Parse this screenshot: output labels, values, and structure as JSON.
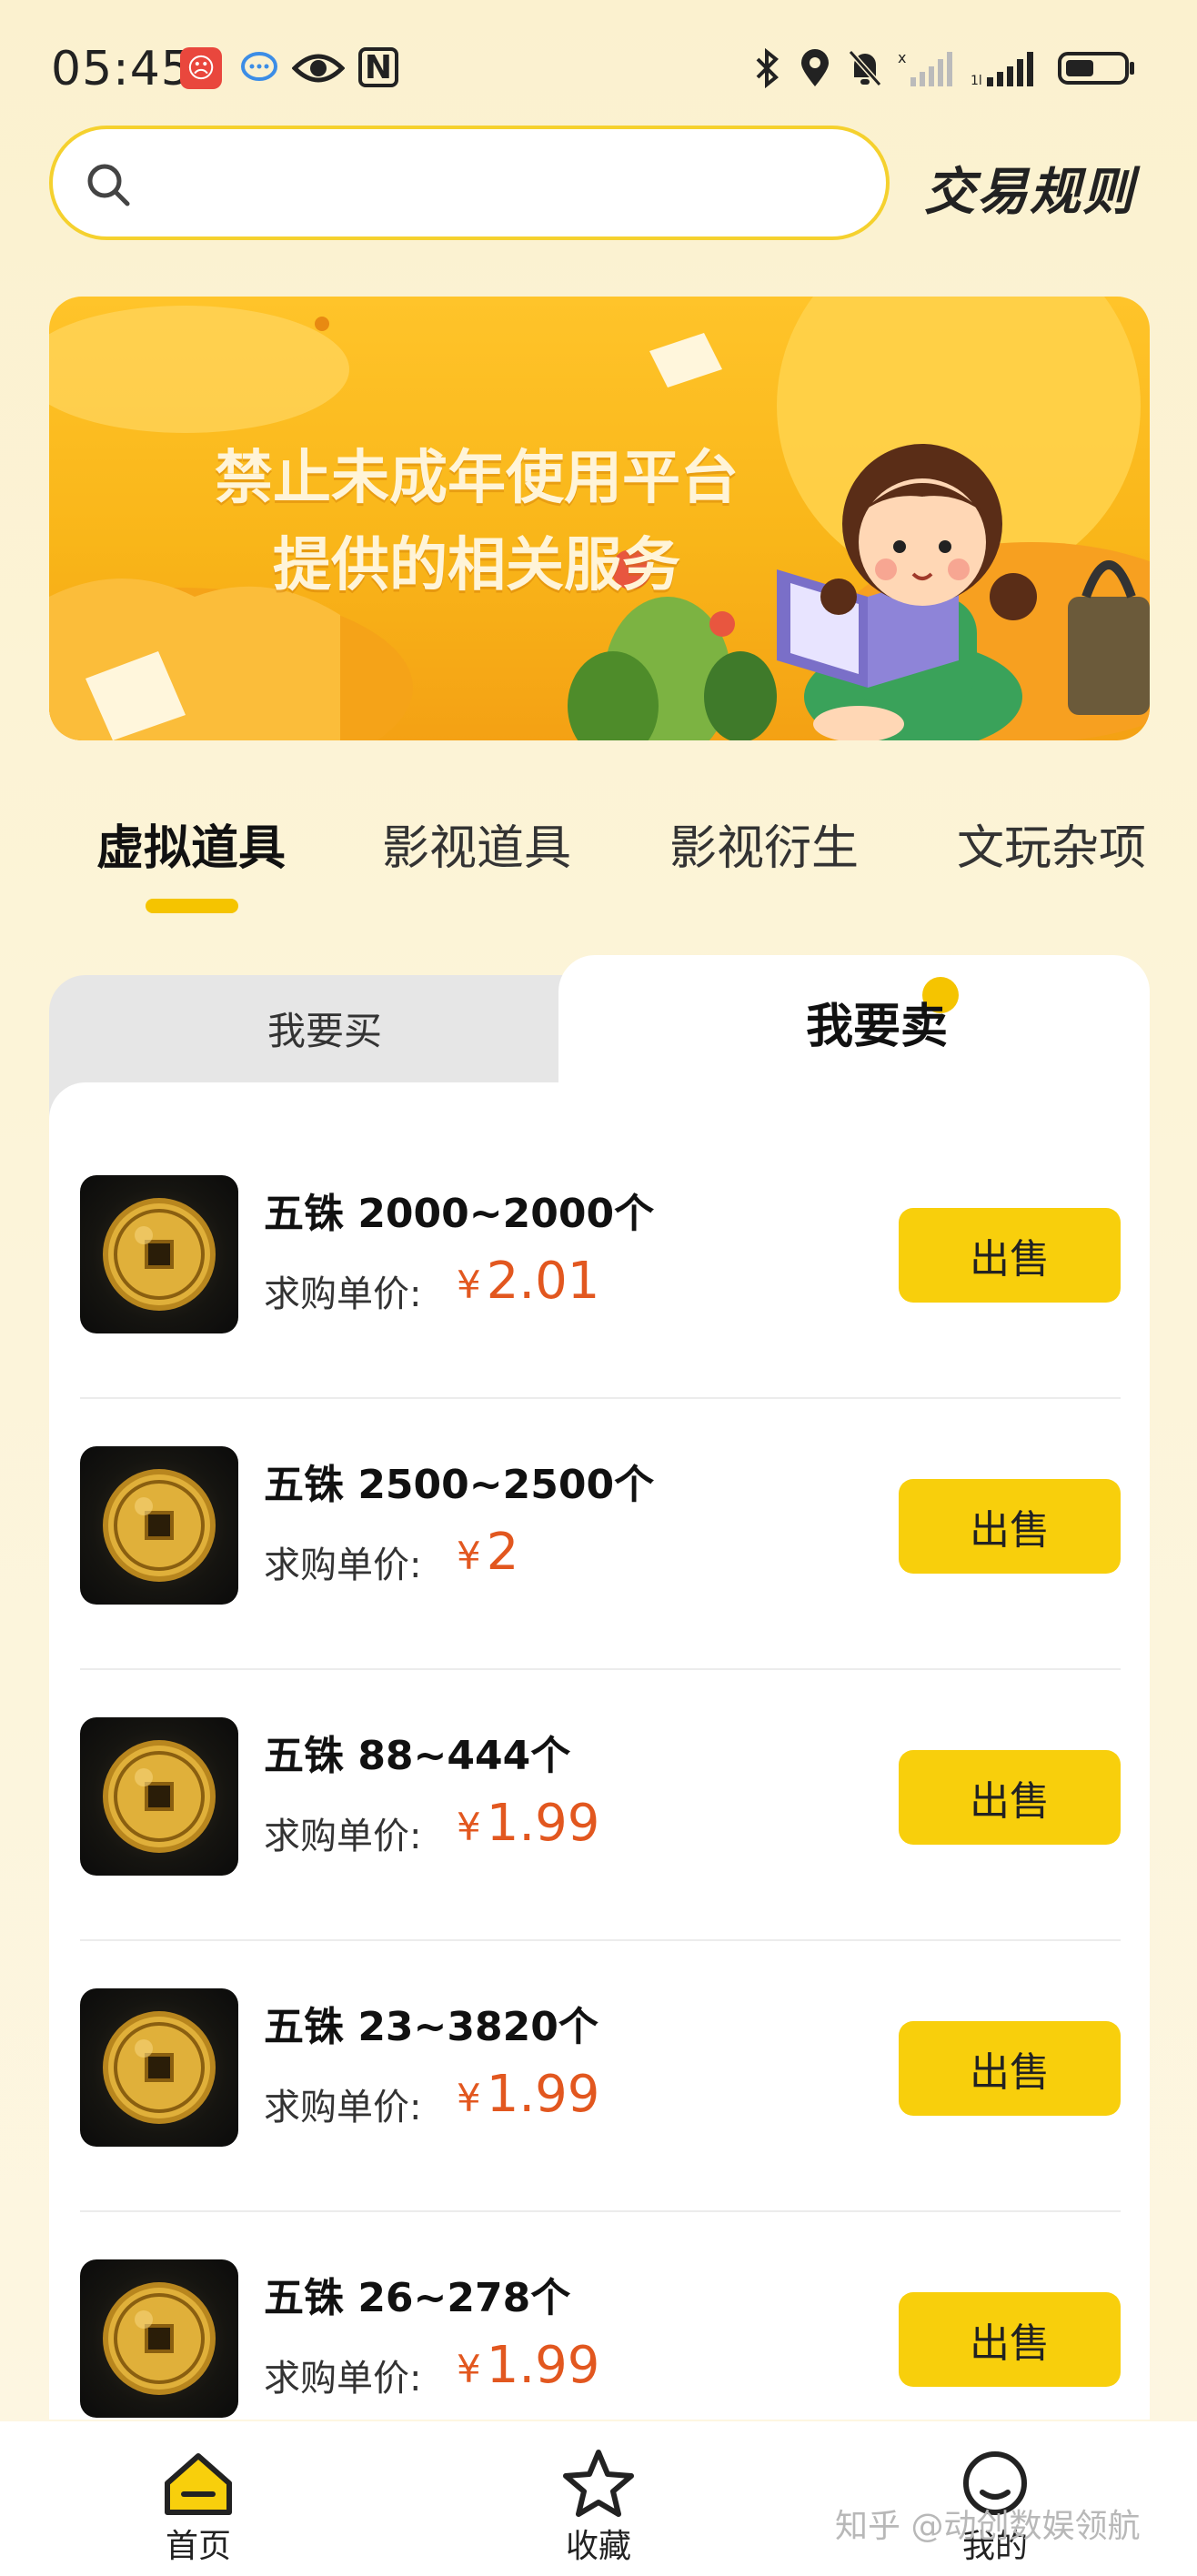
{
  "status_bar": {
    "time": "05:45"
  },
  "header": {
    "search_placeholder": "",
    "rules_link": "交易规则"
  },
  "banner": {
    "line1": "禁止未成年使用平台",
    "line2": "提供的相关服务"
  },
  "category_tabs": [
    {
      "label": "虚拟道具",
      "active": true
    },
    {
      "label": "影视道具",
      "active": false
    },
    {
      "label": "影视衍生",
      "active": false
    },
    {
      "label": "文玩杂项",
      "active": false
    }
  ],
  "trade_toggle": {
    "buy_label": "我要买",
    "sell_label": "我要卖",
    "selected": "sell"
  },
  "listing": {
    "price_label": "求购单价:",
    "currency": "¥",
    "sell_button": "出售",
    "items": [
      {
        "name": "五铢 2000~2000个",
        "price": "2.01"
      },
      {
        "name": "五铢 2500~2500个",
        "price": "2"
      },
      {
        "name": "五铢 88~444个",
        "price": "1.99"
      },
      {
        "name": "五铢 23~3820个",
        "price": "1.99"
      },
      {
        "name": "五铢 26~278个",
        "price": "1.99"
      }
    ]
  },
  "bottom_nav": [
    {
      "label": "首页",
      "icon": "home-icon",
      "active": true
    },
    {
      "label": "收藏",
      "icon": "star-icon",
      "active": false
    },
    {
      "label": "我的",
      "icon": "profile-icon",
      "active": false
    }
  ],
  "watermark": "知乎 @动创数娱领航",
  "colors": {
    "accent_yellow": "#f8cf0c",
    "price_orange": "#e2571f",
    "background": "#fbf1cf"
  }
}
